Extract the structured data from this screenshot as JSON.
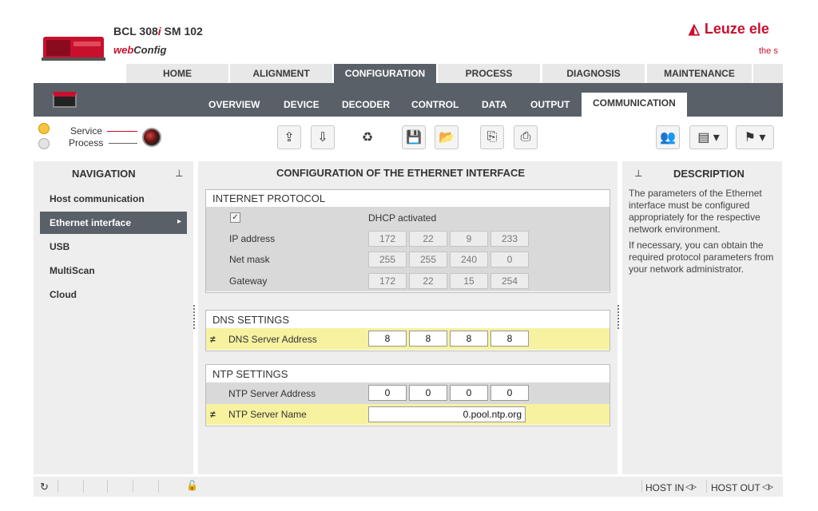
{
  "header": {
    "product_prefix": "BCL 308",
    "product_i": "i",
    "product_suffix": " SM 102",
    "app_web": "web",
    "app_config": "Config",
    "brand": "Leuze ele",
    "brand_tag": "the s"
  },
  "main_tabs": [
    "HOME",
    "ALIGNMENT",
    "CONFIGURATION",
    "PROCESS",
    "DIAGNOSIS",
    "MAINTENANCE"
  ],
  "sub_tabs": [
    "OVERVIEW",
    "DEVICE",
    "DECODER",
    "CONTROL",
    "DATA",
    "OUTPUT",
    "COMMUNICATION"
  ],
  "mode": {
    "service": "Service",
    "process": "Process"
  },
  "toolbar": {
    "icons": [
      "upload-param-icon",
      "download-param-icon",
      "recycle-icon",
      "save-icon",
      "load-icon",
      "export-icon",
      "print-icon",
      "users-icon",
      "view-menu-icon",
      "language-flag-icon"
    ]
  },
  "navigation": {
    "title": "NAVIGATION",
    "items": [
      "Host communication",
      "Ethernet interface",
      "USB",
      "MultiScan",
      "Cloud"
    ],
    "active": "Ethernet interface"
  },
  "center": {
    "title": "CONFIGURATION OF THE ETHERNET INTERFACE",
    "internet_protocol": {
      "title": "INTERNET PROTOCOL",
      "dhcp_label": "DHCP activated",
      "dhcp_checked": true,
      "ip_label": "IP address",
      "ip": [
        "172",
        "22",
        "9",
        "233"
      ],
      "mask_label": "Net mask",
      "mask": [
        "255",
        "255",
        "240",
        "0"
      ],
      "gw_label": "Gateway",
      "gw": [
        "172",
        "22",
        "15",
        "254"
      ]
    },
    "dns": {
      "title": "DNS SETTINGS",
      "server_label": "DNS Server Address",
      "server": [
        "8",
        "8",
        "8",
        "8"
      ]
    },
    "ntp": {
      "title": "NTP SETTINGS",
      "addr_label": "NTP Server Address",
      "addr": [
        "0",
        "0",
        "0",
        "0"
      ],
      "name_label": "NTP Server Name",
      "name": "0.pool.ntp.org"
    },
    "modified_marker": "≠"
  },
  "description": {
    "title": "DESCRIPTION",
    "para1": "The parameters of the Ethernet interface must be configured appropriately for the respective network environment.",
    "para2": "If necessary, you can obtain the required protocol parameters from your network administrator."
  },
  "status_bar": {
    "host_in": "HOST IN",
    "host_out": "HOST OUT"
  },
  "colors": {
    "accent_red": "#c8102e",
    "dark_bar": "#5a6068",
    "modified_yellow": "#f6f2a0"
  }
}
